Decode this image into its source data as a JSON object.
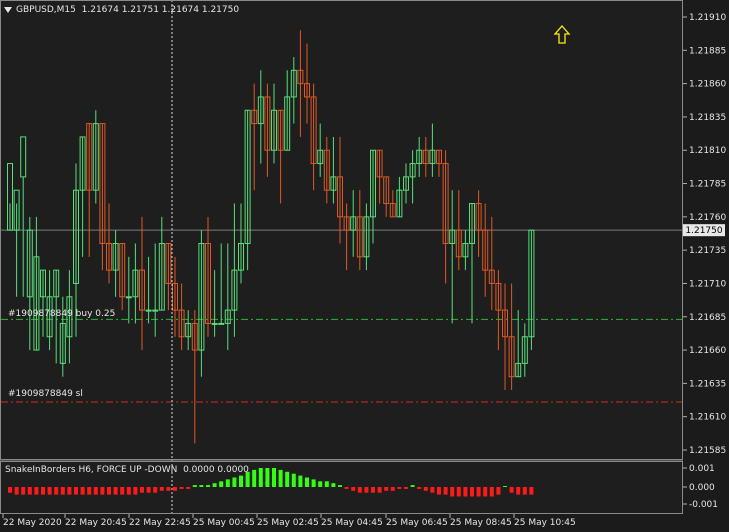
{
  "header": {
    "symbol": "GBPUSD,M15",
    "ohlc": "1.21674 1.21751 1.21674 1.21750"
  },
  "orders": [
    {
      "label": "#1909878849 buy 0.25",
      "price": 1.21683,
      "color": "#2db82d"
    },
    {
      "label": "#1909878849 sl",
      "price": 1.21621,
      "color": "#d02c24"
    }
  ],
  "current_price": {
    "label": "1.21750",
    "value": 1.2175
  },
  "indicator": {
    "title": "SnakeInBorders H6, FORCE UP -DOWN",
    "values": "0.0000 0.0000",
    "ticks": [
      "0.001",
      "0.000",
      "-0.001"
    ],
    "up_color": "#33ff11",
    "down_color": "#ff1a1a"
  },
  "arrow_icon": "up-arrow-signal-icon",
  "colors": {
    "bull": "#55e07a",
    "bear": "#e05822",
    "grid_line": "#7b7b7b",
    "text": "#e6e6e6",
    "arrow": "#ffee00"
  },
  "chart_data": {
    "type": "candlestick",
    "y_ticks": [
      "1.21910",
      "1.21885",
      "1.21860",
      "1.21835",
      "1.21810",
      "1.21785",
      "1.21760",
      "1.21735",
      "1.21710",
      "1.21685",
      "1.21660",
      "1.21635",
      "1.21610",
      "1.21585"
    ],
    "x_ticks": [
      "22 May 2020",
      "22 May 20:45",
      "22 May 22:45",
      "25 May 00:45",
      "25 May 02:45",
      "25 May 04:45",
      "25 May 06:45",
      "25 May 08:45",
      "25 May 10:45"
    ],
    "ylim": [
      1.2158,
      1.2192
    ],
    "candles": [
      [
        1.2175,
        1.218,
        1.2177,
        1.2175
      ],
      [
        1.2175,
        1.2178,
        1.2177,
        1.217
      ],
      [
        1.2179,
        1.2182,
        1.2179,
        1.217
      ],
      [
        1.217,
        1.2175,
        1.2176,
        1.2166
      ],
      [
        1.2166,
        1.2173,
        1.2176,
        1.2166
      ],
      [
        1.217,
        1.2172,
        1.2172,
        1.2167
      ],
      [
        1.2167,
        1.217,
        1.2172,
        1.2166
      ],
      [
        1.217,
        1.2172,
        1.2172,
        1.2165
      ],
      [
        1.2165,
        1.2168,
        1.217,
        1.2164
      ],
      [
        1.2167,
        1.217,
        1.2172,
        1.2165
      ],
      [
        1.2171,
        1.2178,
        1.218,
        1.2167
      ],
      [
        1.2178,
        1.2182,
        1.2182,
        1.2173
      ],
      [
        1.2183,
        1.2178,
        1.2183,
        1.2173
      ],
      [
        1.2178,
        1.2183,
        1.2184,
        1.2177
      ],
      [
        1.2183,
        1.2174,
        1.2183,
        1.2172
      ],
      [
        1.2174,
        1.2172,
        1.2177,
        1.2171
      ],
      [
        1.2172,
        1.2174,
        1.2175,
        1.217
      ],
      [
        1.2174,
        1.217,
        1.2174,
        1.2169
      ],
      [
        1.217,
        1.217,
        1.2173,
        1.2168
      ],
      [
        1.217,
        1.2172,
        1.2174,
        1.2168
      ],
      [
        1.2172,
        1.2169,
        1.2176,
        1.2166
      ],
      [
        1.2169,
        1.2169,
        1.2173,
        1.2168
      ],
      [
        1.2169,
        1.2169,
        1.2174,
        1.2167
      ],
      [
        1.2169,
        1.2174,
        1.2176,
        1.2169
      ],
      [
        1.2174,
        1.2171,
        1.2174,
        1.2169
      ],
      [
        1.2171,
        1.2169,
        1.2173,
        1.2167
      ],
      [
        1.2169,
        1.2167,
        1.2171,
        1.2166
      ],
      [
        1.2167,
        1.2168,
        1.2169,
        1.2166
      ],
      [
        1.2168,
        1.2166,
        1.2169,
        1.2159
      ],
      [
        1.2166,
        1.2174,
        1.2175,
        1.2164
      ],
      [
        1.2174,
        1.2168,
        1.2176,
        1.2167
      ],
      [
        1.2168,
        1.2168,
        1.2172,
        1.2167
      ],
      [
        1.2168,
        1.2168,
        1.2174,
        1.2168
      ],
      [
        1.2168,
        1.2169,
        1.2174,
        1.2166
      ],
      [
        1.2169,
        1.2172,
        1.2177,
        1.2167
      ],
      [
        1.2172,
        1.2174,
        1.2177,
        1.2171
      ],
      [
        1.2174,
        1.2184,
        1.2184,
        1.2172
      ],
      [
        1.2184,
        1.2183,
        1.2186,
        1.2178
      ],
      [
        1.2183,
        1.2185,
        1.2187,
        1.218
      ],
      [
        1.2185,
        1.2181,
        1.2186,
        1.2179
      ],
      [
        1.2181,
        1.2184,
        1.2186,
        1.218
      ],
      [
        1.2184,
        1.2181,
        1.2184,
        1.2177
      ],
      [
        1.2181,
        1.2185,
        1.2187,
        1.2181
      ],
      [
        1.2185,
        1.2187,
        1.2188,
        1.2183
      ],
      [
        1.2187,
        1.2186,
        1.219,
        1.2182
      ],
      [
        1.2186,
        1.2185,
        1.2189,
        1.2183
      ],
      [
        1.2185,
        1.218,
        1.2186,
        1.2178
      ],
      [
        1.218,
        1.2181,
        1.2183,
        1.2179
      ],
      [
        1.2181,
        1.2178,
        1.2182,
        1.2177
      ],
      [
        1.2178,
        1.2179,
        1.2182,
        1.2177
      ],
      [
        1.2179,
        1.2176,
        1.2182,
        1.2174
      ],
      [
        1.2176,
        1.2175,
        1.2177,
        1.2172
      ],
      [
        1.2175,
        1.2176,
        1.2178,
        1.2173
      ],
      [
        1.2176,
        1.2173,
        1.2178,
        1.2172
      ],
      [
        1.2173,
        1.2176,
        1.2177,
        1.2172
      ],
      [
        1.2176,
        1.2181,
        1.2181,
        1.2174
      ],
      [
        1.2181,
        1.2179,
        1.2181,
        1.2177
      ],
      [
        1.2179,
        1.2177,
        1.2179,
        1.2176
      ],
      [
        1.2177,
        1.2176,
        1.2178,
        1.2176
      ],
      [
        1.2176,
        1.2178,
        1.2179,
        1.2176
      ],
      [
        1.2178,
        1.2179,
        1.218,
        1.2177
      ],
      [
        1.2179,
        1.218,
        1.2181,
        1.2177
      ],
      [
        1.218,
        1.2181,
        1.2182,
        1.2179
      ],
      [
        1.2181,
        1.218,
        1.2182,
        1.2179
      ],
      [
        1.218,
        1.2181,
        1.2183,
        1.2179
      ],
      [
        1.2181,
        1.218,
        1.2181,
        1.2179
      ],
      [
        1.218,
        1.2174,
        1.2181,
        1.2171
      ],
      [
        1.2174,
        1.2175,
        1.2178,
        1.2168
      ],
      [
        1.2175,
        1.2173,
        1.2178,
        1.2172
      ],
      [
        1.2173,
        1.2174,
        1.2175,
        1.2172
      ],
      [
        1.2174,
        1.2177,
        1.2177,
        1.2168
      ],
      [
        1.2177,
        1.2175,
        1.2178,
        1.2173
      ],
      [
        1.2175,
        1.2172,
        1.2177,
        1.217
      ],
      [
        1.2172,
        1.2171,
        1.2176,
        1.2169
      ],
      [
        1.2171,
        1.2169,
        1.2172,
        1.2166
      ],
      [
        1.2169,
        1.2167,
        1.2171,
        1.2163
      ],
      [
        1.2167,
        1.2164,
        1.2171,
        1.2163
      ],
      [
        1.2164,
        1.2165,
        1.2169,
        1.2164
      ],
      [
        1.2165,
        1.2167,
        1.2168,
        1.2164
      ],
      [
        1.2167,
        1.2175,
        1.2175,
        1.2166
      ]
    ],
    "indicator_values": [
      -0.0003,
      -0.0004,
      -0.0004,
      -0.0004,
      -0.0004,
      -0.0004,
      -0.0004,
      -0.0004,
      -0.0004,
      -0.0004,
      -0.0004,
      -0.0004,
      -0.0004,
      -0.0004,
      -0.0004,
      -0.0004,
      -0.0004,
      -0.0004,
      -0.0004,
      -0.0004,
      -0.0003,
      -0.0003,
      -0.0003,
      -0.0002,
      -0.0002,
      -0.0002,
      -0.0001,
      -0.0001,
      0.0001,
      0.0001,
      0.0001,
      0.0002,
      0.0003,
      0.0004,
      0.0005,
      0.0006,
      0.0008,
      0.0009,
      0.001,
      0.001,
      0.001,
      0.0009,
      0.0008,
      0.0007,
      0.0006,
      0.0005,
      0.0004,
      0.0003,
      0.0003,
      0.0002,
      0.0001,
      -0.0001,
      -0.0002,
      -0.0003,
      -0.0003,
      -0.0003,
      -0.0003,
      -0.0002,
      -0.0002,
      -0.0001,
      -0.0001,
      0.0001,
      -0.0001,
      -0.0002,
      -0.0003,
      -0.0004,
      -0.0004,
      -0.0005,
      -0.0005,
      -0.0005,
      -0.0005,
      -0.0005,
      -0.0005,
      -0.0005,
      -0.0004,
      0.0,
      -0.0003,
      -0.0004,
      -0.0004,
      -0.0004
    ]
  }
}
